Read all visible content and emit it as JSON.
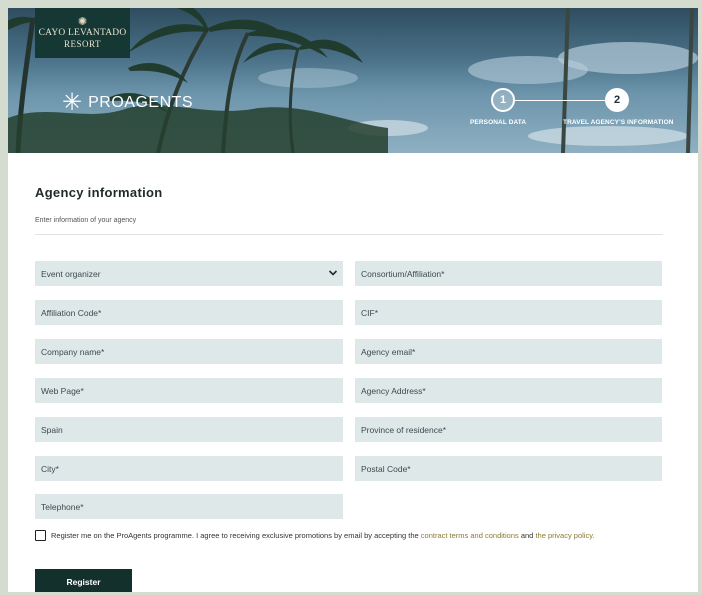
{
  "header": {
    "resort_logo_line1": "CAYO LEVANTADO",
    "resort_logo_line2": "RESORT",
    "brand_name": "PROAGENTS",
    "steps": [
      {
        "number": "1",
        "label": "PERSONAL DATA",
        "state": "completed"
      },
      {
        "number": "2",
        "label": "TRAVEL AGENCY'S INFORMATION",
        "state": "active"
      }
    ]
  },
  "form": {
    "title": "Agency information",
    "subtitle": "Enter information of your agency",
    "fields": {
      "event_organizer": "Event organizer",
      "consortium": "Consortium/Affiliation*",
      "affiliation_code": "Affiliation Code*",
      "cif": "CIF*",
      "company_name": "Company name*",
      "agency_email": "Agency email*",
      "web_page": "Web Page*",
      "agency_address": "Agency Address*",
      "country": "Spain",
      "province": "Province of residence*",
      "city": "City*",
      "postal_code": "Postal Code*",
      "telephone": "Telephone*"
    },
    "consent": {
      "text_before": "Register me on the ProAgents programme. I agree to receiving exclusive promotions by email by accepting the",
      "terms_link": "contract terms and conditions",
      "and": "and",
      "privacy_link": "the privacy policy.",
      "checked": false
    },
    "submit_label": "Register"
  },
  "colors": {
    "page_background": "#d4dccf",
    "field_background": "#dfe8e9",
    "button_background": "#14302c",
    "link": "#8a7a34"
  }
}
